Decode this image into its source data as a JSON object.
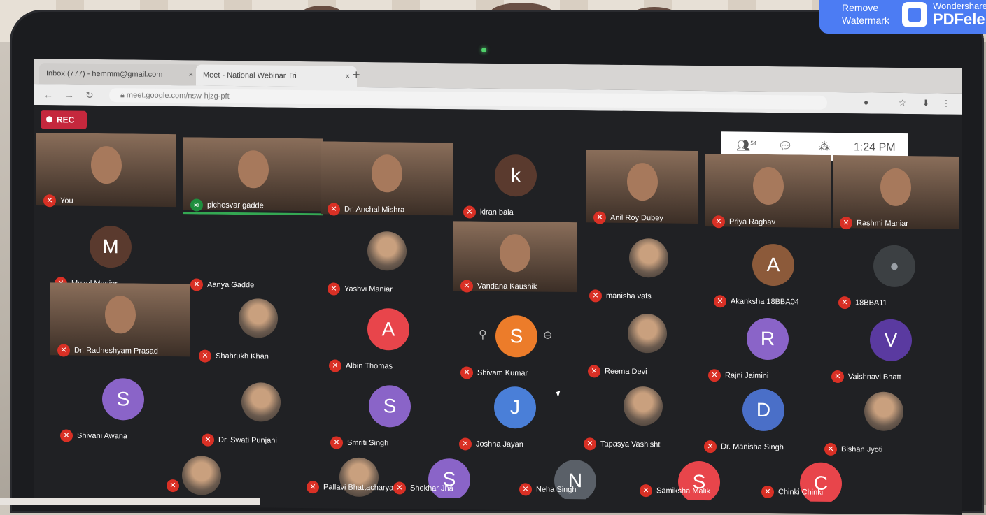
{
  "browser": {
    "tabs": [
      {
        "label": "Inbox (777) - hemmm@gmail.com",
        "close": "×"
      },
      {
        "label": "Meet - National Webinar Tri",
        "close": "×"
      }
    ],
    "new_tab": "+",
    "url": "meet.google.com/nsw-hjzg-pft"
  },
  "meet": {
    "rec_label": "REC",
    "participants_count": "54",
    "time": "1:24 PM",
    "participants": [
      {
        "name": "You",
        "type": "video"
      },
      {
        "name": "pichesvar gadde",
        "type": "video",
        "speaking": true
      },
      {
        "name": "Dr. Anchal Mishra",
        "type": "video"
      },
      {
        "name": "kiran bala",
        "type": "avatar",
        "initial": "k"
      },
      {
        "name": "Anil Roy Dubey",
        "type": "video"
      },
      {
        "name": "Priya Raghav",
        "type": "video"
      },
      {
        "name": "Rashmi Maniar",
        "type": "video"
      },
      {
        "name": "Mukul Maniar",
        "type": "avatar",
        "initial": "M"
      },
      {
        "name": "Aanya Gadde",
        "type": "blank"
      },
      {
        "name": "Yashvi Maniar",
        "type": "photo"
      },
      {
        "name": "Vandana Kaushik",
        "type": "video"
      },
      {
        "name": "manisha vats",
        "type": "photo"
      },
      {
        "name": "Akanksha 18BBA04",
        "type": "avatar",
        "initial": "A"
      },
      {
        "name": "18BBA11",
        "type": "avatar",
        "initial": ""
      },
      {
        "name": "Dr. Radheshyam Prasad",
        "type": "video"
      },
      {
        "name": "Shahrukh Khan",
        "type": "photo"
      },
      {
        "name": "Albin Thomas",
        "type": "avatar",
        "initial": "A"
      },
      {
        "name": "Shivam Kumar",
        "type": "avatar",
        "initial": "S"
      },
      {
        "name": "Reema Devi",
        "type": "photo"
      },
      {
        "name": "Rajni Jaimini",
        "type": "avatar",
        "initial": "R"
      },
      {
        "name": "Vaishnavi Bhatt",
        "type": "avatar",
        "initial": "V"
      },
      {
        "name": "Shivani Awana",
        "type": "avatar",
        "initial": "S"
      },
      {
        "name": "Dr. Swati Punjani",
        "type": "photo"
      },
      {
        "name": "Smriti Singh",
        "type": "avatar",
        "initial": "S"
      },
      {
        "name": "Joshna Jayan",
        "type": "avatar",
        "initial": "J"
      },
      {
        "name": "Tapasya Vashisht",
        "type": "photo"
      },
      {
        "name": "Dr. Manisha Singh",
        "type": "avatar",
        "initial": "D"
      },
      {
        "name": "Bishan Jyoti",
        "type": "photo"
      },
      {
        "name": "",
        "type": "photo"
      },
      {
        "name": "Pallavi Bhattacharya",
        "type": "photo"
      },
      {
        "name": "Shekhar Jha",
        "type": "avatar",
        "initial": "S"
      },
      {
        "name": "Neha Singh",
        "type": "avatar",
        "initial": "N"
      },
      {
        "name": "Samiksha Malik",
        "type": "avatar",
        "initial": "S"
      },
      {
        "name": "Chinki Chinki",
        "type": "avatar",
        "initial": "C"
      }
    ]
  },
  "watermark": {
    "line1": "Remove",
    "line2": "Watermark",
    "brand_top": "Wondershare",
    "brand_main": "PDFelement"
  },
  "colors": {
    "mic_off": "#d93025",
    "speaking": "#1e8e3e",
    "watermark_bg": "#4c7cf3"
  }
}
